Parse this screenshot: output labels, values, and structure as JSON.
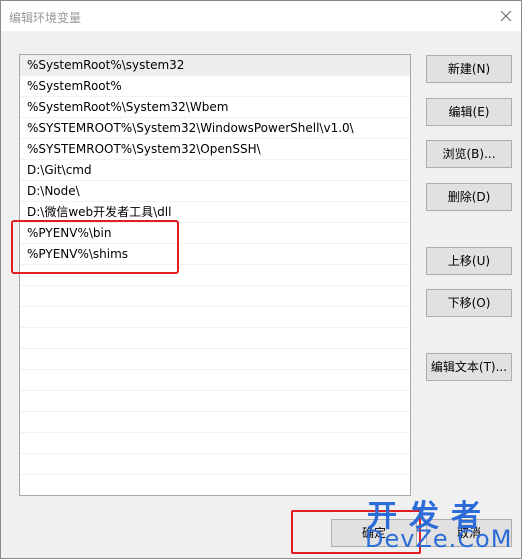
{
  "window": {
    "title": "编辑环境变量"
  },
  "list": {
    "items": [
      "%SystemRoot%\\system32",
      "%SystemRoot%",
      "%SystemRoot%\\System32\\Wbem",
      "%SYSTEMROOT%\\System32\\WindowsPowerShell\\v1.0\\",
      "%SYSTEMROOT%\\System32\\OpenSSH\\",
      "D:\\Git\\cmd",
      "D:\\Node\\",
      "D:\\微信web开发者工具\\dll",
      "%PYENV%\\bin",
      "%PYENV%\\shims"
    ]
  },
  "buttons": {
    "new": "新建(N)",
    "edit": "编辑(E)",
    "browse": "浏览(B)...",
    "delete": "删除(D)",
    "move_up": "上移(U)",
    "move_down": "下移(O)",
    "edit_text": "编辑文本(T)...",
    "ok": "确定",
    "cancel": "取消"
  },
  "watermark": {
    "cn": "开发者",
    "en": "DevZe.CoM"
  },
  "colors": {
    "highlight": "#e02020",
    "watermark": "#2b6cd8"
  }
}
